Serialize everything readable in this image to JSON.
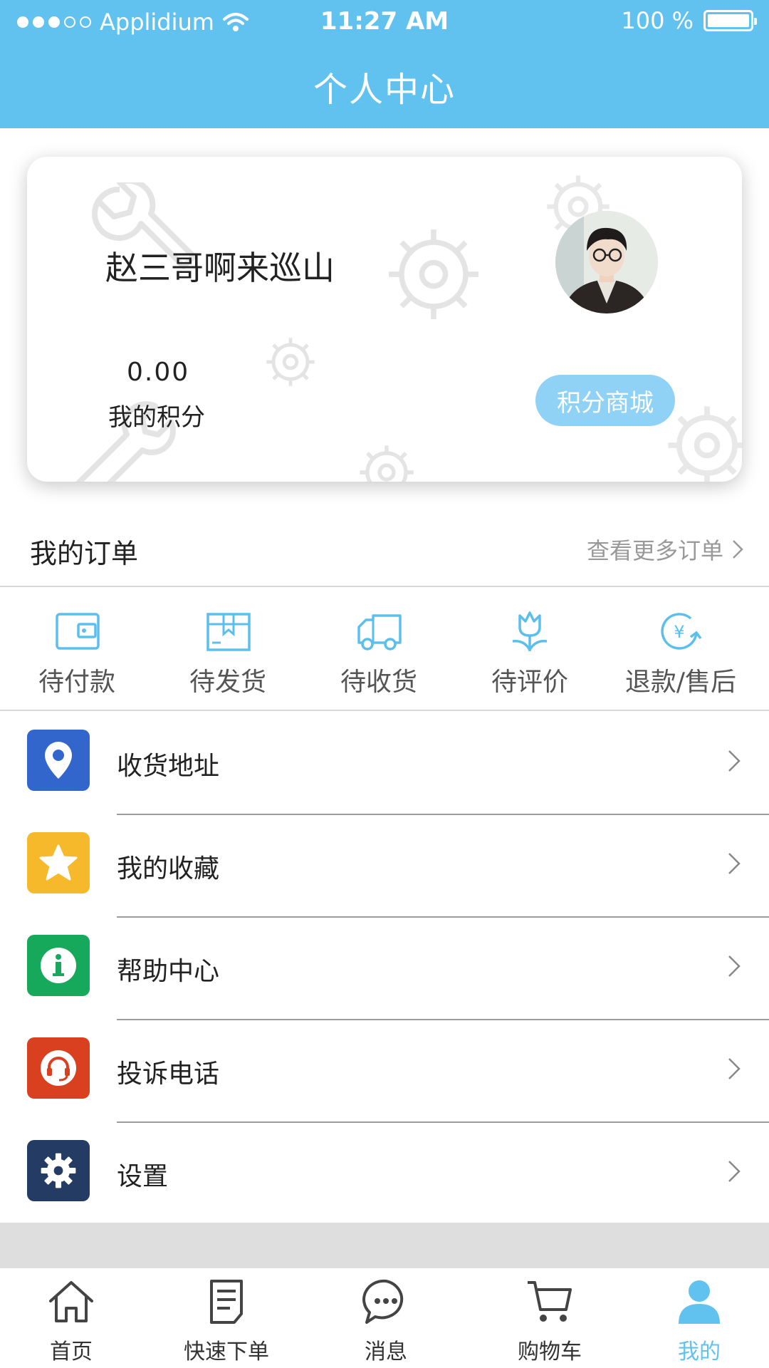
{
  "status_bar": {
    "carrier": "Applidium",
    "time": "11:27 AM",
    "battery": "100 %",
    "battery_level": 1.0
  },
  "page": {
    "title": "个人中心"
  },
  "profile": {
    "username": "赵三哥啊来巡山",
    "points_value": "0.00",
    "points_label": "我的积分",
    "mall_button": "积分商城"
  },
  "orders": {
    "title": "我的订单",
    "more_link": "查看更多订单",
    "tabs": [
      {
        "label": "待付款",
        "icon": "wallet-icon"
      },
      {
        "label": "待发货",
        "icon": "package-icon"
      },
      {
        "label": "待收货",
        "icon": "truck-icon"
      },
      {
        "label": "待评价",
        "icon": "tulip-icon"
      },
      {
        "label": "退款/售后",
        "icon": "yen-refund-icon"
      }
    ]
  },
  "menu": {
    "items": [
      {
        "label": "收货地址",
        "icon": "location-pin-icon",
        "color": "#3366cc"
      },
      {
        "label": "我的收藏",
        "icon": "star-icon",
        "color": "#f6b92b"
      },
      {
        "label": "帮助中心",
        "icon": "info-icon",
        "color": "#16a95b"
      },
      {
        "label": "投诉电话",
        "icon": "headset-icon",
        "color": "#d9401f"
      },
      {
        "label": "设置",
        "icon": "gear-icon",
        "color": "#243b63"
      }
    ]
  },
  "tabbar": {
    "items": [
      {
        "label": "首页",
        "icon": "home-icon"
      },
      {
        "label": "快速下单",
        "icon": "document-icon"
      },
      {
        "label": "消息",
        "icon": "chat-bubble-icon"
      },
      {
        "label": "购物车",
        "icon": "cart-icon"
      },
      {
        "label": "我的",
        "icon": "user-icon"
      }
    ],
    "active_index": 4
  },
  "colors": {
    "primary": "#62c2ef",
    "mall_button": "#8fd2f5",
    "order_icon": "#5bbfee",
    "divider": "#d8d8d8"
  }
}
